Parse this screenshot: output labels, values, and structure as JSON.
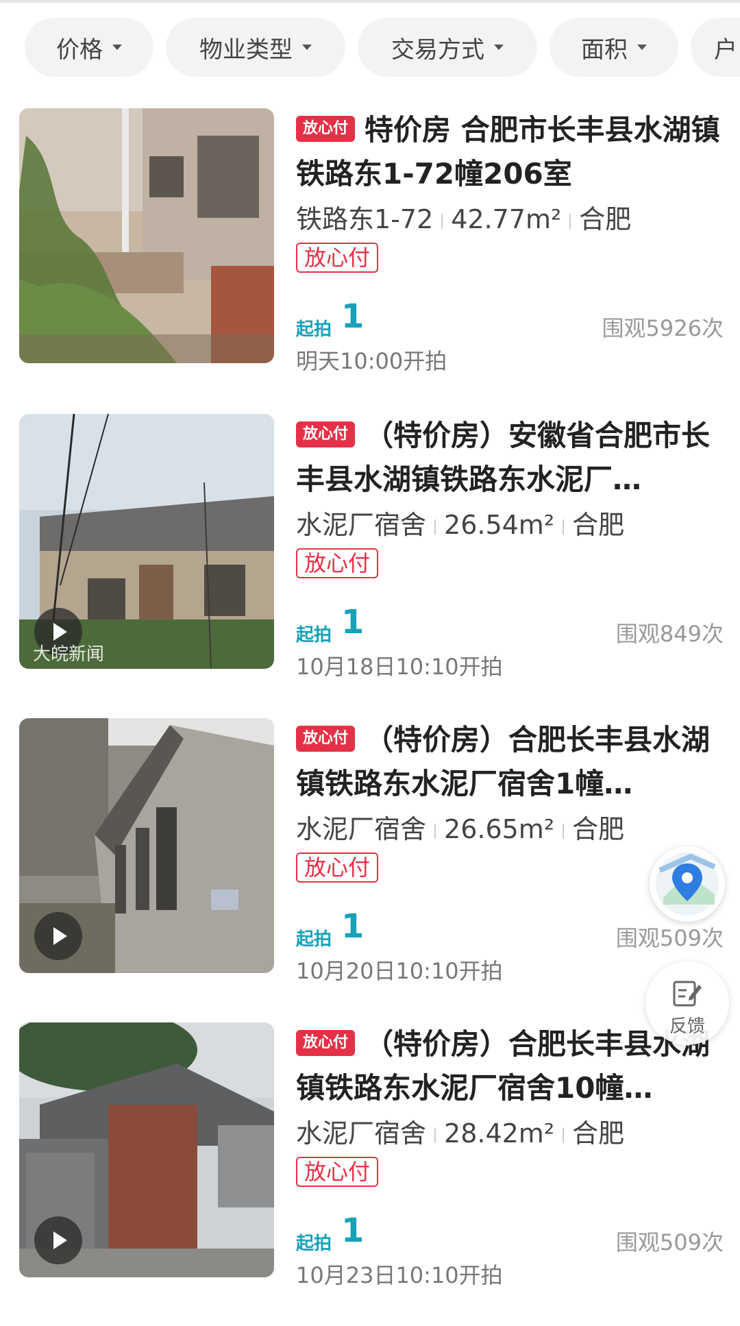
{
  "filters": [
    {
      "label": "价格",
      "icon": "caret-down-icon"
    },
    {
      "label": "物业类型",
      "icon": "caret-down-icon"
    },
    {
      "label": "交易方式",
      "icon": "caret-down-icon"
    },
    {
      "label": "面积",
      "icon": "caret-down-icon"
    },
    {
      "label": "户",
      "icon": ""
    }
  ],
  "listings": [
    {
      "tag": "放心付",
      "title": "特价房 合肥市长丰县水湖镇铁路东1-72幢206室",
      "community": "铁路东1-72",
      "area": "42.77m²",
      "city": "合肥",
      "badge": "放心付",
      "start_label": "起拍",
      "start_value": "1",
      "views": "围观5926次",
      "time": "明天10:00开拍",
      "has_video": false
    },
    {
      "tag": "放心付",
      "title": "（特价房）安徽省合肥市长丰县水湖镇铁路东水泥厂…",
      "community": "水泥厂宿舍",
      "area": "26.54m²",
      "city": "合肥",
      "badge": "放心付",
      "start_label": "起拍",
      "start_value": "1",
      "views": "围观849次",
      "time": "10月18日10:10开拍",
      "has_video": true,
      "watermark": "大皖新闻"
    },
    {
      "tag": "放心付",
      "title": "（特价房）合肥长丰县水湖镇铁路东水泥厂宿舍1幢…",
      "community": "水泥厂宿舍",
      "area": "26.65m²",
      "city": "合肥",
      "badge": "放心付",
      "start_label": "起拍",
      "start_value": "1",
      "views": "围观509次",
      "time": "10月20日10:10开拍",
      "has_video": true
    },
    {
      "tag": "放心付",
      "title": "（特价房）合肥长丰县水湖镇铁路东水泥厂宿舍10幢…",
      "community": "水泥厂宿舍",
      "area": "28.42m²",
      "city": "合肥",
      "badge": "放心付",
      "start_label": "起拍",
      "start_value": "1",
      "views": "围观509次",
      "time": "10月23日10:10开拍",
      "has_video": true
    }
  ],
  "floating": {
    "map_icon": "map-pin-icon",
    "feedback_icon": "edit-note-icon",
    "feedback_label": "反馈"
  },
  "colors": {
    "accent_red": "#e53047",
    "accent_teal": "#16a2b8"
  }
}
